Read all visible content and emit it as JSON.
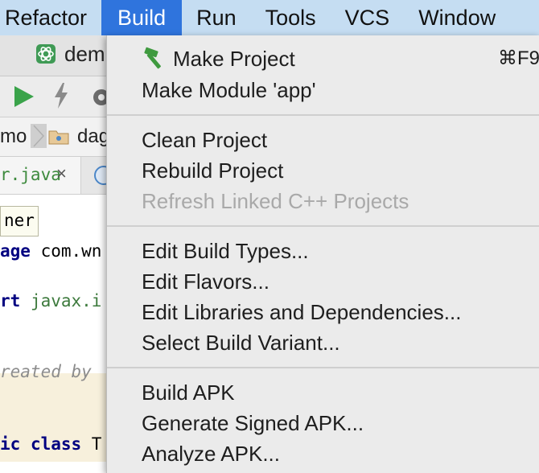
{
  "menubar": {
    "items": [
      "Refactor",
      "Build",
      "Run",
      "Tools",
      "VCS",
      "Window"
    ],
    "active": "Build"
  },
  "ide": {
    "title_fragment": "dem",
    "breadcrumb_1": "mo",
    "breadcrumb_2": "dag",
    "tab_label": "r.java",
    "tab_close": "×",
    "hint": "ner",
    "code": {
      "line1_kw": "age",
      "line1_rest": " com.wn",
      "line2_kw": "rt",
      "line2_rest": " javax.i",
      "line3": "reated by",
      "line4_kw1": "ic",
      "line4_kw2": " class",
      "line4_rest": " T"
    }
  },
  "build_menu": {
    "make_project": "Make Project",
    "make_project_shortcut": "⌘F9",
    "make_module": "Make Module 'app'",
    "clean_project": "Clean Project",
    "rebuild_project": "Rebuild Project",
    "refresh_cpp": "Refresh Linked C++ Projects",
    "edit_build_types": "Edit Build Types...",
    "edit_flavors": "Edit Flavors...",
    "edit_libraries": "Edit Libraries and Dependencies...",
    "select_build_variant": "Select Build Variant...",
    "build_apk": "Build APK",
    "generate_signed_apk": "Generate Signed APK...",
    "analyze_apk": "Analyze APK..."
  },
  "icons": {
    "make_project": "hammer-icon",
    "app": "android-studio-icon",
    "run": "run-icon",
    "apply": "lightning-icon",
    "sdk": "gear-icon",
    "folder": "folder-icon"
  },
  "colors": {
    "menubar": "#c5ddf2",
    "active_menu": "#2f74dd",
    "dropdown": "#ebebeb",
    "disabled": "#a9a9a9",
    "hammer": "#3f9a3f"
  }
}
